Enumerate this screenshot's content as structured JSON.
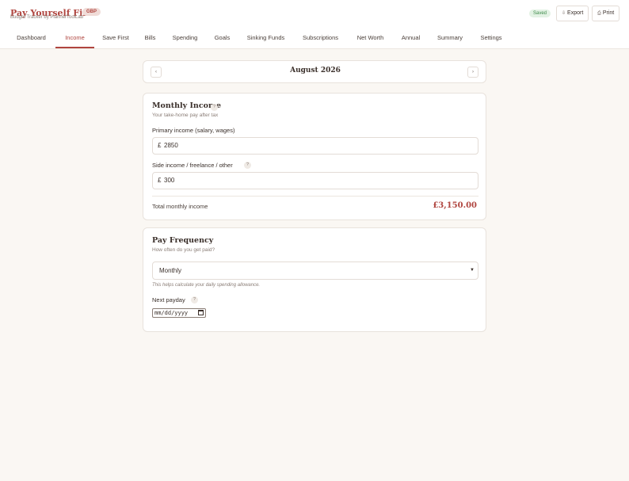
{
  "app": {
    "title": "Pay Yourself First",
    "subtitle": "Budget Tracker by PlannerToolLab",
    "currency": "GBP",
    "status": "Saved",
    "export_label": "Export",
    "print_label": "Print"
  },
  "nav": {
    "active": "Income",
    "items": [
      "Dashboard",
      "Income",
      "Save First",
      "Bills",
      "Spending",
      "Goals",
      "Sinking Funds",
      "Subscriptions",
      "Net Worth",
      "Annual",
      "Summary",
      "Settings"
    ]
  },
  "month": {
    "prev": "‹",
    "next": "›",
    "label": "August 2026"
  },
  "income": {
    "title": "Monthly Income",
    "subtitle": "Your take-home pay after tax",
    "help": "?",
    "primary_label": "Primary income (salary, wages)",
    "currency_symbol": "£",
    "primary_value": "2850",
    "side_label": "Side income / freelance / other",
    "side_value": "300",
    "total_label": "Total monthly income",
    "total_value": "£3,150.00"
  },
  "frequency": {
    "title": "Pay Frequency",
    "subtitle": "How often do you get paid?",
    "selected": "Monthly",
    "hint": "This helps calculate your daily spending allowance.",
    "next_payday_label": "Next payday",
    "next_payday_value": "mm/dd/yyyy"
  },
  "colors": {
    "accent": "#b0453f",
    "background": "#faf7f3",
    "saved": "#3d8a4a"
  },
  "icons": {
    "export": "download-icon",
    "print": "printer-icon",
    "help": "question-icon",
    "calendar": "calendar-icon",
    "select": "chevron-down-icon"
  }
}
